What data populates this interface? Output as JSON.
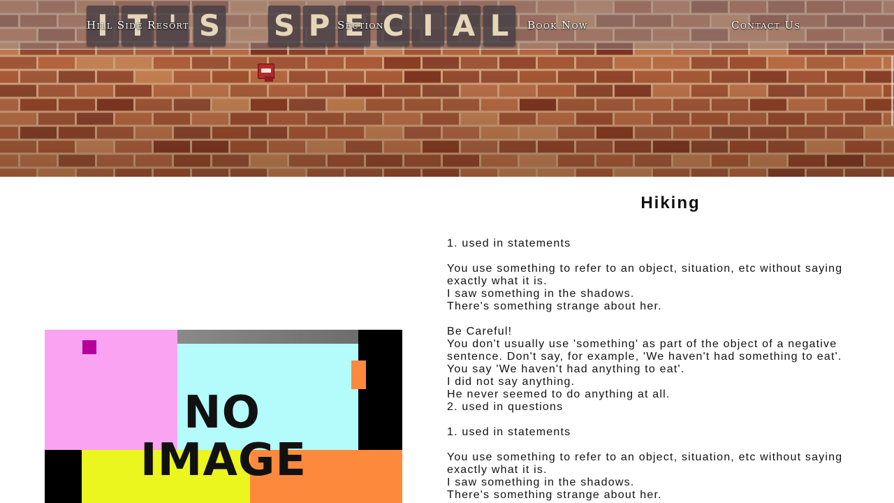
{
  "header": {
    "banner_tiles": [
      "I",
      "T",
      "'",
      "S",
      "S",
      "P",
      "E",
      "C",
      "I",
      "A",
      "L"
    ],
    "nav": [
      {
        "label": "Hill Side Resort"
      },
      {
        "label": "Section"
      },
      {
        "label": "Book Now"
      },
      {
        "label": "Contact Us"
      }
    ]
  },
  "image": {
    "text_line1": "NO",
    "text_line2": "IMAGE"
  },
  "article": {
    "title": "Hiking",
    "lines": [
      "1. used in statements",
      "",
      "You use something to refer to an object, situation, etc without saying",
      "exactly what it is.",
      "I saw something in the shadows.",
      "There's something strange about her.",
      "",
      "Be Careful!",
      "You don't usually use 'something' as part of the object of a negative",
      "sentence. Don't say, for example, 'We haven't had something to eat'.",
      "You say 'We haven't had anything to eat'.",
      "I did not say anything.",
      "He never seemed to do anything at all.",
      "2. used in questions",
      "",
      "1. used in statements",
      "",
      "You use something to refer to an object, situation, etc without saying",
      "exactly what it is.",
      "I saw something in the shadows.",
      "There's something strange about her."
    ]
  },
  "colors": {
    "nav_text": "#ffffff",
    "tile_bg": "#463e44",
    "tile_text": "#e6d6b8",
    "brick": "#9a4a2c",
    "mortar": "#d8b48c",
    "placeholder_pink": "#f9a3f2",
    "placeholder_cyan": "#b3fcfb",
    "placeholder_yellow": "#ebf51e",
    "placeholder_orange": "#fd8a3c",
    "placeholder_magenta": "#b5009b"
  }
}
